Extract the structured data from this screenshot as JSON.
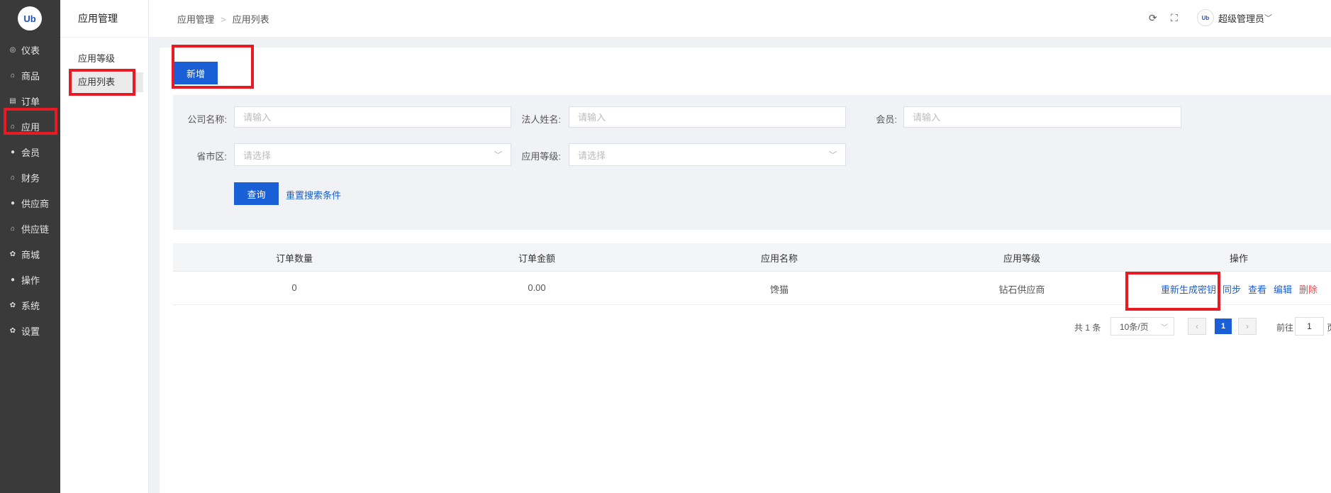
{
  "brand": {
    "logo_text": "Ub"
  },
  "rail": {
    "items": [
      {
        "icon": "dashboard-icon",
        "glyph": "◎",
        "label": "仪表"
      },
      {
        "icon": "bag-icon",
        "glyph": "⌂",
        "label": "商品"
      },
      {
        "icon": "clipboard-icon",
        "glyph": "▤",
        "label": "订单"
      },
      {
        "icon": "bag-icon",
        "glyph": "⌂",
        "label": "应用"
      },
      {
        "icon": "user-icon",
        "glyph": "●",
        "label": "会员"
      },
      {
        "icon": "bag-icon",
        "glyph": "⌂",
        "label": "财务"
      },
      {
        "icon": "user-icon",
        "glyph": "●",
        "label": "供应商"
      },
      {
        "icon": "bag-icon",
        "glyph": "⌂",
        "label": "供应链"
      },
      {
        "icon": "gear-icon",
        "glyph": "✿",
        "label": "商城"
      },
      {
        "icon": "user-icon",
        "glyph": "●",
        "label": "操作"
      },
      {
        "icon": "gear-icon",
        "glyph": "✿",
        "label": "系统"
      },
      {
        "icon": "gear-icon",
        "glyph": "✿",
        "label": "设置"
      }
    ],
    "active_label": "应用"
  },
  "submenu": {
    "title": "应用管理",
    "items": [
      "应用等级",
      "应用列表"
    ],
    "active_label": "应用列表"
  },
  "header": {
    "breadcrumb": [
      "应用管理",
      "应用列表"
    ],
    "refresh_icon": "⟳",
    "fullscreen_icon": "⛶",
    "user_name": "超级管理员",
    "user_chevron": "﹀"
  },
  "toolbar": {
    "add_label": "新增"
  },
  "filters": {
    "company": {
      "label": "公司名称:",
      "placeholder": "请输入",
      "value": ""
    },
    "legal_person": {
      "label": "法人姓名:",
      "placeholder": "请输入",
      "value": ""
    },
    "member": {
      "label": "会员:",
      "placeholder": "请输入",
      "value": ""
    },
    "region": {
      "label": "省市区:",
      "placeholder": "请选择"
    },
    "app_level": {
      "label": "应用等级:",
      "placeholder": "请选择"
    },
    "query_label": "查询",
    "reset_label": "重置搜索条件"
  },
  "table": {
    "columns": [
      "订单数量",
      "订单金额",
      "应用名称",
      "应用等级",
      "操作"
    ],
    "rows": [
      {
        "order_count": "0",
        "order_amount": "0.00",
        "app_name": "馋猫",
        "app_level": "钻石供应商",
        "actions": {
          "regen": "重新生成密钥",
          "sync": "同步",
          "view": "查看",
          "edit": "编辑",
          "delete": "删除"
        }
      }
    ]
  },
  "pagination": {
    "total_text": "共 1 条",
    "page_size": "10条/页",
    "prev": "‹",
    "next": "›",
    "current_page": "1",
    "goto_label": "前往",
    "goto_value": "1",
    "page_suffix": "页"
  },
  "colors": {
    "primary": "#1a5fd6",
    "danger": "#f04848",
    "sidebar_bg": "#3a3a3a",
    "highlight_box": "#e81b25"
  }
}
